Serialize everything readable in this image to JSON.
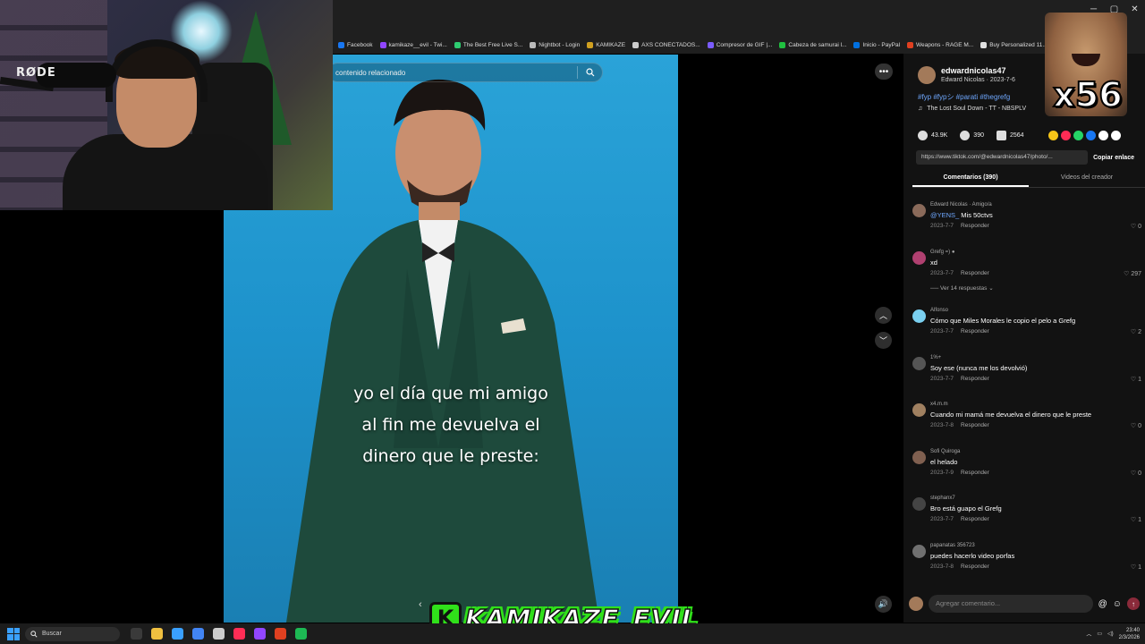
{
  "window": {
    "controls": [
      "─",
      "▢",
      "✕"
    ]
  },
  "bookmarks": [
    {
      "label": "Facebook",
      "color": "#1877f2"
    },
    {
      "label": "kamikaze__evil - Twi...",
      "color": "#9146ff"
    },
    {
      "label": "The Best Free Live S...",
      "color": "#2ecc71"
    },
    {
      "label": "Nightbot - Login",
      "color": "#bbbbbb"
    },
    {
      "label": "KAMIKAZE",
      "color": "#d0a020"
    },
    {
      "label": "AXS CONECTADOS...",
      "color": "#cccccc"
    },
    {
      "label": "Compresor de GIF |...",
      "color": "#7b5cff"
    },
    {
      "label": "Cabeza de samurai l...",
      "color": "#20c040"
    },
    {
      "label": "Inicio - PayPal",
      "color": "#0070e0"
    },
    {
      "label": "Weapons - RAGE M...",
      "color": "#e04020"
    },
    {
      "label": "Buy Personalized 11...",
      "color": "#e0e0e0"
    }
  ],
  "webcam": {
    "mic_brand": "RØDE"
  },
  "search": {
    "placeholder": "contenido relacionado"
  },
  "video": {
    "caption_lines": [
      "yo el día que mi amigo",
      "al fin me devuelva el",
      "dinero que le preste:"
    ]
  },
  "controls": {
    "more": "•••",
    "up": "︿",
    "down": "﹀",
    "volume": "🔊",
    "prev": "‹"
  },
  "post": {
    "username": "edwardnicolas47",
    "subline": "Edward Nicolas · 2023-7-6",
    "hashtags": "#fyp #fypシ #parati #thegrefg",
    "music": "The Lost Soul Down - TT - NBSPLV",
    "likes": "43.9K",
    "comments": "390",
    "saves": "2564",
    "link": "https://www.tiktok.com/@edwardnicolas47/photo/...",
    "copy_label": "Copiar enlace",
    "share_colors": [
      "#f5c518",
      "#fe2c55",
      "#25d366",
      "#1877f2",
      "#ffffff",
      "#ffffff"
    ]
  },
  "overlay": {
    "count": "x56"
  },
  "tabs": [
    "Comentarios (390)",
    "Videos del creador"
  ],
  "comments": [
    {
      "user": "Edward Nicolas · Amigo/a",
      "mention": "@YENS_",
      "text": " Mis 50ctvs",
      "date": "2023-7-7",
      "reply": "Responder",
      "likes": "0",
      "color": "#8a6a5a"
    },
    {
      "user": "Grefg =) ●",
      "mention": "",
      "text": "xd",
      "date": "2023-7-7",
      "reply": "Responder",
      "likes": "297",
      "more": "── Ver 14 respuestas ⌄",
      "color": "#b04070"
    },
    {
      "user": "Alfonso",
      "mention": "",
      "text": "Cómo que Miles Morales le copio el pelo a Grefg",
      "date": "2023-7-7",
      "reply": "Responder",
      "likes": "2",
      "color": "#7ad0f0"
    },
    {
      "user": "1%+",
      "mention": "",
      "text": "Soy ese (nunca me los devolvió)",
      "date": "2023-7-7",
      "reply": "Responder",
      "likes": "1",
      "color": "#555555"
    },
    {
      "user": "x4.m.m",
      "mention": "",
      "text": "Cuando mi mamá me devuelva el dinero que le preste",
      "date": "2023-7-8",
      "reply": "Responder",
      "likes": "0",
      "color": "#a08060"
    },
    {
      "user": "Sofi Quiroga",
      "mention": "",
      "text": "el helado",
      "date": "2023-7-9",
      "reply": "Responder",
      "likes": "0",
      "color": "#806050"
    },
    {
      "user": "stephanx7",
      "mention": "",
      "text": "Bro está guapo el Grefg",
      "date": "2023-7-7",
      "reply": "Responder",
      "likes": "1",
      "color": "#444444"
    },
    {
      "user": "papanatas 356723",
      "mention": "",
      "text": "puedes hacerlo video porfas",
      "date": "2023-7-8",
      "reply": "Responder",
      "likes": "1",
      "color": "#707070"
    }
  ],
  "comment_box": {
    "placeholder": "Agregar comentario...",
    "at": "@",
    "emoji": "☺",
    "send": "↑"
  },
  "streamer": {
    "badge": "K",
    "name": "KAMIKAZE_EVIL"
  },
  "taskbar": {
    "search_label": "Buscar",
    "apps": [
      "#3a3a3a",
      "#f0c040",
      "#3aa0ff",
      "#4285f4",
      "#cccccc",
      "#ff2d55",
      "#9146ff",
      "#e04020",
      "#1db954"
    ],
    "time": "23:40",
    "date": "2/3/2026"
  }
}
